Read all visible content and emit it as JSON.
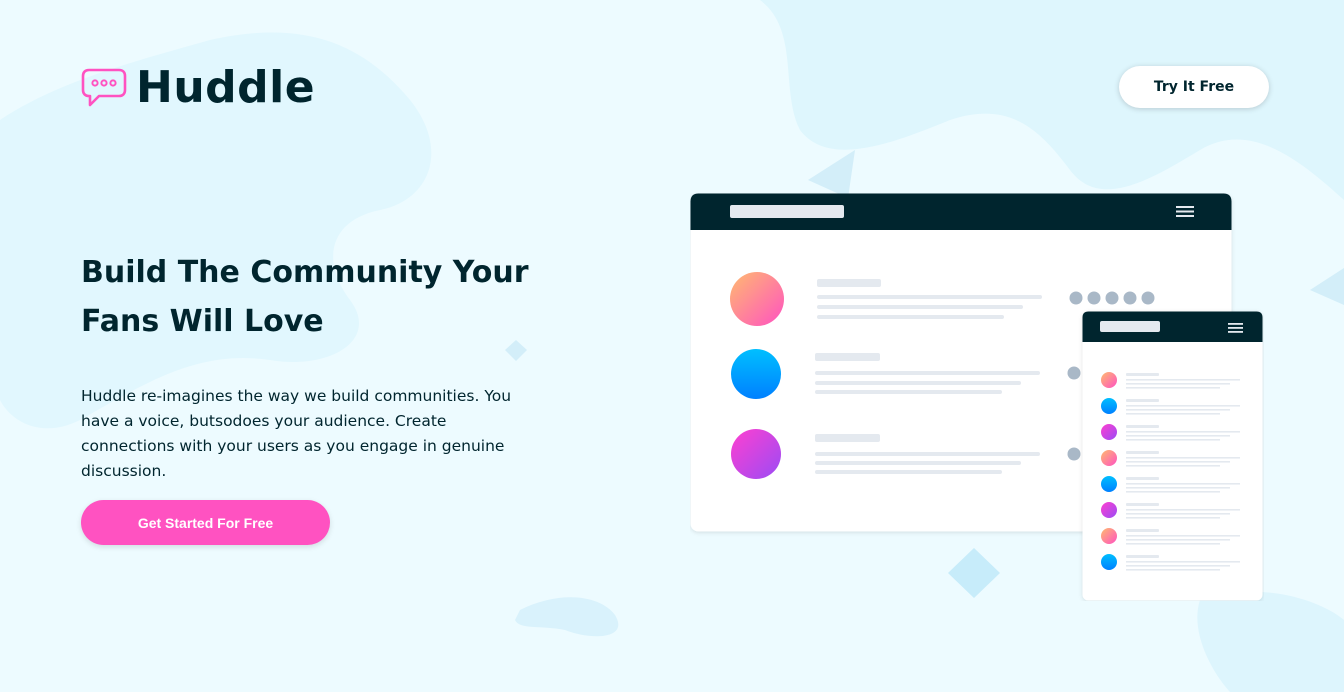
{
  "brand": {
    "name": "Huddle",
    "icon": "chat-bubble-icon",
    "icon_color": "#ff52c1"
  },
  "header": {
    "cta_label": "Try It Free"
  },
  "hero": {
    "title": "Build The Community Your Fans Will Love",
    "description": "Huddle re-imagines the way we build communities. You have a voice, butsodoes your audience. Create connections with your users as you engage in genuine discussion.",
    "cta_label": "Get Started For Free"
  },
  "colors": {
    "background": "#edfbff",
    "dark": "#00252e",
    "accent": "#ff52c1",
    "white": "#ffffff"
  },
  "illustration": {
    "name": "app-mockup-illustration",
    "menu_icon": "hamburger-menu-icon"
  }
}
